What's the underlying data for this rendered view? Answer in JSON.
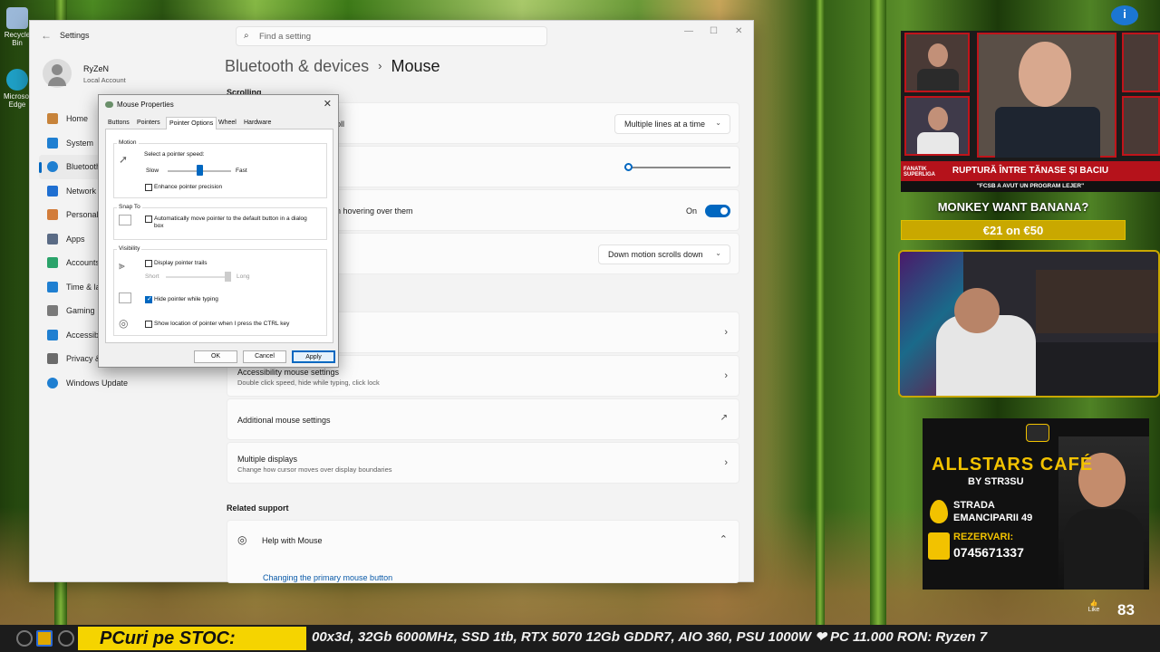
{
  "desktop": {
    "icons": [
      {
        "label": "Recycle Bin",
        "color": "#9bb8d8"
      },
      {
        "label": "Microsoft Edge",
        "color": "#1fa0c6"
      }
    ]
  },
  "settings": {
    "app_title": "Settings",
    "search_placeholder": "Find a setting",
    "user": {
      "name": "RyZeN",
      "type": "Local Account"
    },
    "nav": [
      {
        "label": "Home",
        "icon": "home-icon",
        "color": "#c7833a"
      },
      {
        "label": "System",
        "icon": "system-icon",
        "color": "#1f7fd1"
      },
      {
        "label": "Bluetooth & devices",
        "icon": "bluetooth-icon",
        "color": "#1f7fd1",
        "active": true
      },
      {
        "label": "Network & internet",
        "icon": "network-icon",
        "color": "#1f6fd1"
      },
      {
        "label": "Personalization",
        "icon": "brush-icon",
        "color": "#d27c3a"
      },
      {
        "label": "Apps",
        "icon": "apps-icon",
        "color": "#5a6b85"
      },
      {
        "label": "Accounts",
        "icon": "accounts-icon",
        "color": "#2aa36a"
      },
      {
        "label": "Time & language",
        "icon": "clock-icon",
        "color": "#1f7fd1"
      },
      {
        "label": "Gaming",
        "icon": "gaming-icon",
        "color": "#7a7a7a"
      },
      {
        "label": "Accessibility",
        "icon": "accessibility-icon",
        "color": "#1f7fd1"
      },
      {
        "label": "Privacy & security",
        "icon": "shield-icon",
        "color": "#6b6b6b"
      },
      {
        "label": "Windows Update",
        "icon": "update-icon",
        "color": "#1f7fd1"
      }
    ],
    "breadcrumb": {
      "parent": "Bluetooth & devices",
      "separator": "›",
      "current": "Mouse"
    },
    "scrolling_label": "Scrolling",
    "rows": {
      "scroll_label": "oll",
      "scroll_value": "Multiple lines at a time",
      "hover_label": "n hovering over them",
      "hover_state": "On",
      "direction_value": "Down motion scrolls down",
      "accessibility_title": "Accessibility mouse settings",
      "accessibility_sub": "Double click speed, hide while typing, click lock",
      "additional": "Additional mouse settings",
      "displays_title": "Multiple displays",
      "displays_sub": "Change how cursor moves over display boundaries"
    },
    "scroll_lines_fraction": 0.0,
    "related_label": "Related support",
    "help": {
      "title": "Help with Mouse",
      "link": "Changing the primary mouse button"
    }
  },
  "dialog": {
    "title": "Mouse Properties",
    "tabs": [
      "Buttons",
      "Pointers",
      "Pointer Options",
      "Wheel",
      "Hardware"
    ],
    "active_tab": "Pointer Options",
    "motion": {
      "group": "Motion",
      "label": "Select a pointer speed:",
      "slow": "Slow",
      "fast": "Fast",
      "speed_fraction": 0.5,
      "precision": "Enhance pointer precision",
      "precision_checked": false
    },
    "snap": {
      "group": "Snap To",
      "label": "Automatically move pointer to the default button in a dialog box",
      "checked": false
    },
    "visibility": {
      "group": "Visibility",
      "trails": "Display pointer trails",
      "trails_checked": false,
      "short": "Short",
      "long": "Long",
      "hide": "Hide pointer while typing",
      "hide_checked": true,
      "show": "Show location of pointer when I press the CTRL key",
      "show_checked": false
    },
    "buttons": {
      "ok": "OK",
      "cancel": "Cancel",
      "apply": "Apply"
    }
  },
  "overlay": {
    "news_tag": "FANATIK SUPERLIGA",
    "headline": "RUPTURĂ ÎNTRE TĂNASE ȘI BACIU",
    "subheadline": "\"FCSB A AVUT UN PROGRAM LEJER\"",
    "monkey_title": "MONKEY WANT BANANA?",
    "monkey_offer": "€21 on €50",
    "ad": {
      "title": "ALLSTARS CAFÉ",
      "subtitle": "BY STR3SU",
      "street": "STRADA",
      "address": "EMANCIPARII 49",
      "rez": "REZERVARI:",
      "phone": "0745671337"
    },
    "like_label": "Like",
    "like_count": "83"
  },
  "ticker": {
    "label": "PCuri pe STOC:",
    "text": "00x3d, 32Gb 6000MHz, SSD 1tb, RTX 5070 12Gb GDDR7, AIO 360, PSU 1000W ❤ PC 11.000 RON: Ryzen 7"
  }
}
